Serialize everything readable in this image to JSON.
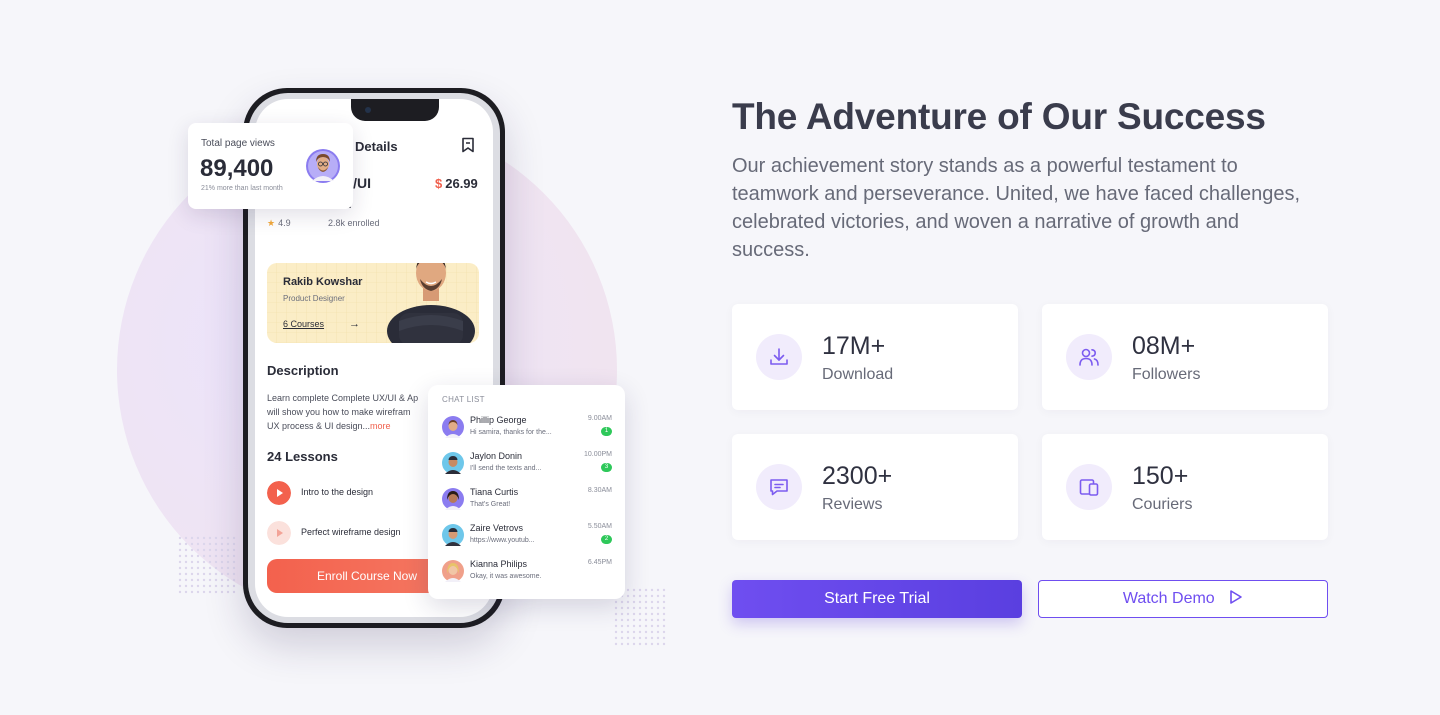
{
  "phone": {
    "screen_title": "Details",
    "course_name_line1": "K/UI",
    "course_name_line2": "n",
    "price_symbol": "$",
    "price_value": "26.99",
    "rating": "4.9",
    "enrolled": "2.8k enrolled",
    "mentor": {
      "name": "Rakib Kowshar",
      "role": "Product Designer",
      "courses": "6 Courses"
    },
    "description_heading": "Description",
    "description_line1": "Learn complete Complete UX/UI & Ap",
    "description_line2": "will show you how to make wirefram",
    "description_line3": "UX process & UI design...",
    "description_more": "more",
    "lessons_heading": "24 Lessons",
    "lessons": [
      {
        "title": "Intro to the design"
      },
      {
        "title": "Perfect wireframe design"
      }
    ],
    "enroll_label": "Enroll Course Now"
  },
  "views_card": {
    "label": "Total page views",
    "value": "89,400",
    "sub": "21% more than last month"
  },
  "chat_list": {
    "heading": "CHAT LIST",
    "items": [
      {
        "name": "Phillip George",
        "message": "Hi samira, thanks for the...",
        "time": "9.00AM",
        "badge": "1"
      },
      {
        "name": "Jaylon Donin",
        "message": "I'll send the texts and...",
        "time": "10.00PM",
        "badge": "3"
      },
      {
        "name": "Tiana Curtis",
        "message": "That's Great!",
        "time": "8.30AM",
        "badge": ""
      },
      {
        "name": "Zaire Vetrovs",
        "message": "https://www.youtub...",
        "time": "5.50AM",
        "badge": "2"
      },
      {
        "name": "Kianna Philips",
        "message": "Okay, it was awesome.",
        "time": "6.45PM",
        "badge": ""
      }
    ]
  },
  "hero": {
    "title": "The Adventure of Our Success",
    "lead": "Our achievement story stands as a powerful testament to teamwork and perseverance. United, we have faced challenges, celebrated victories, and woven a narrative of growth and success."
  },
  "stats": [
    {
      "value": "17M+",
      "label": "Download",
      "icon": "download-icon"
    },
    {
      "value": "08M+",
      "label": "Followers",
      "icon": "users-icon"
    },
    {
      "value": "2300+",
      "label": "Reviews",
      "icon": "chat-bubble-icon"
    },
    {
      "value": "150+",
      "label": "Couriers",
      "icon": "devices-icon"
    }
  ],
  "actions": {
    "primary_label": "Start Free Trial",
    "secondary_label": "Watch Demo"
  },
  "colors": {
    "accent": "#6f4ef0",
    "coral": "#f3614d",
    "badge_green": "#2ec85a",
    "icon_bg": "#f1ecfc"
  }
}
